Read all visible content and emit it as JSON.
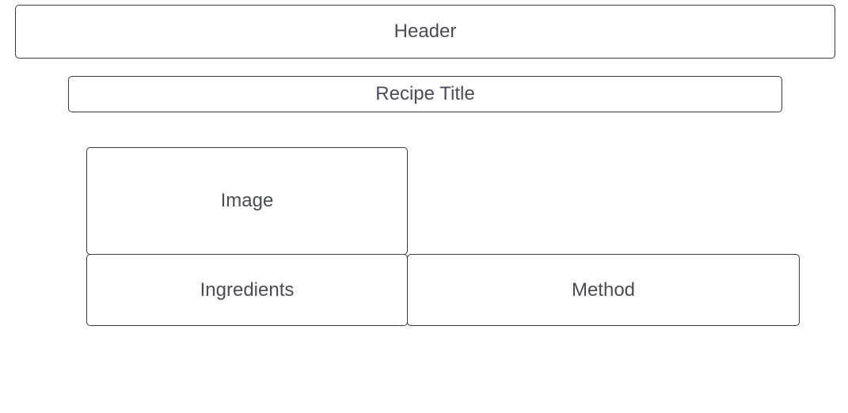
{
  "wireframe": {
    "header_label": "Header",
    "recipe_title_label": "Recipe Title",
    "image_label": "Image",
    "ingredients_label": "Ingredients",
    "method_label": "Method"
  },
  "colors": {
    "border": "#3a3a3a",
    "text": "#4a4d55",
    "background": "#ffffff"
  }
}
